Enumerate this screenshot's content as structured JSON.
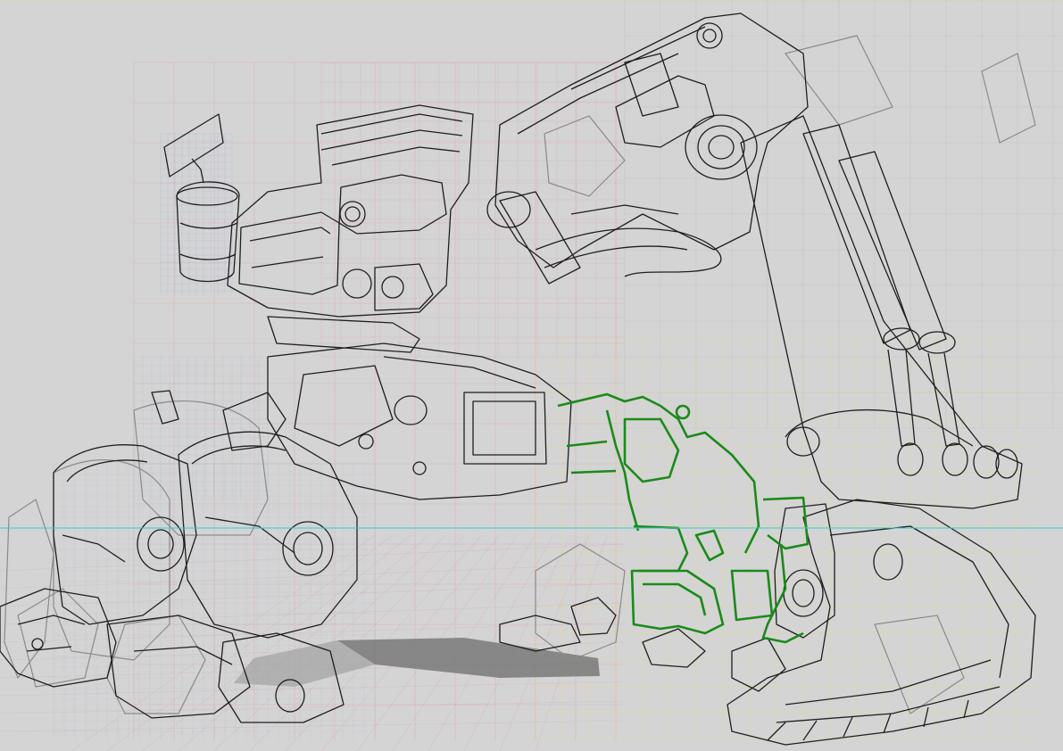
{
  "canvas": {
    "background": "#d4d4d4",
    "colors": {
      "ink": "#1e1e1e",
      "ghost_ink": "#8a8a8a",
      "grid_red": "#e07a8a",
      "grid_blue": "#8ea7e0",
      "grid_yellow": "#e6e060",
      "horizon": "#33ccdd",
      "highlight_green": "#1a8a1a",
      "shadow": "#7a7a7a"
    }
  },
  "layers": [
    {
      "name": "perspective-grid"
    },
    {
      "name": "mech-lineart"
    },
    {
      "name": "green-selection"
    },
    {
      "name": "horizon-line"
    }
  ]
}
